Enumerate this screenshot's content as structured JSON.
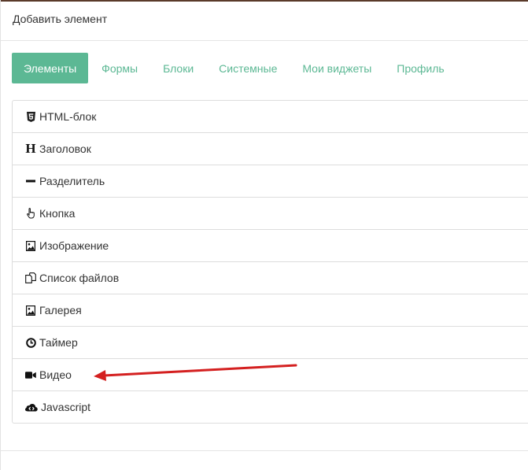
{
  "dialog": {
    "title": "Добавить элемент"
  },
  "tabs": [
    {
      "label": "Элементы",
      "active": true
    },
    {
      "label": "Формы",
      "active": false
    },
    {
      "label": "Блоки",
      "active": false
    },
    {
      "label": "Системные",
      "active": false
    },
    {
      "label": "Мои виджеты",
      "active": false
    },
    {
      "label": "Профиль",
      "active": false
    }
  ],
  "elements": [
    {
      "label": "HTML-блок",
      "icon": "html5-icon"
    },
    {
      "label": "Заголовок",
      "icon": "heading-icon"
    },
    {
      "label": "Разделитель",
      "icon": "minus-icon"
    },
    {
      "label": "Кнопка",
      "icon": "pointer-hand-icon"
    },
    {
      "label": "Изображение",
      "icon": "image-icon"
    },
    {
      "label": "Список файлов",
      "icon": "files-icon"
    },
    {
      "label": "Галерея",
      "icon": "image-icon"
    },
    {
      "label": "Таймер",
      "icon": "clock-icon"
    },
    {
      "label": "Видео",
      "icon": "video-camera-icon"
    },
    {
      "label": "Javascript",
      "icon": "cloud-code-icon"
    }
  ],
  "colors": {
    "accent": "#5cb894",
    "annotation_arrow": "#d42020"
  }
}
